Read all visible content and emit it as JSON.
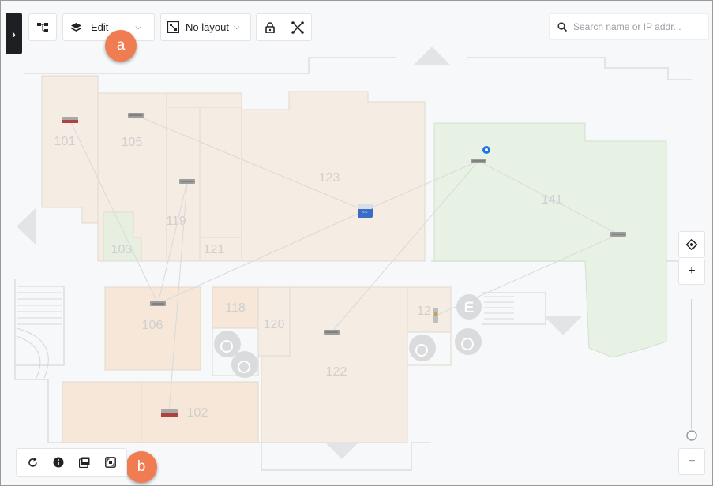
{
  "toolbar": {
    "topology_icon": "topology-icon",
    "mode_label": "Edit",
    "layout_label": "No layout",
    "lock_icon": "lock-icon",
    "expand_icon": "expand-nodes-icon"
  },
  "search": {
    "placeholder": "Search name or IP addr..."
  },
  "callouts": {
    "a": "a",
    "b": "b"
  },
  "zoom": {
    "locate_icon": "locate-icon",
    "zoom_in_label": "+",
    "zoom_out_label": "−",
    "level": 0
  },
  "bottom_toolbar": {
    "items": [
      {
        "name": "refresh-icon"
      },
      {
        "name": "info-icon"
      },
      {
        "name": "pdf-export-icon"
      },
      {
        "name": "fit-screen-icon"
      }
    ]
  },
  "floorplan": {
    "rooms": [
      "101",
      "105",
      "103",
      "119",
      "121",
      "123",
      "141",
      "106",
      "118",
      "120",
      "12",
      "122",
      "102"
    ]
  },
  "colors": {
    "room_fill": "#f5ece4",
    "room_fill_dark": "#f6e7d8",
    "green_zone": "#e8f2e4",
    "wall": "#d7d9dc",
    "accent_callout": "#ef7d51",
    "toolbar_bg": "#ffffff",
    "drawer_bg": "#1d1f22"
  }
}
